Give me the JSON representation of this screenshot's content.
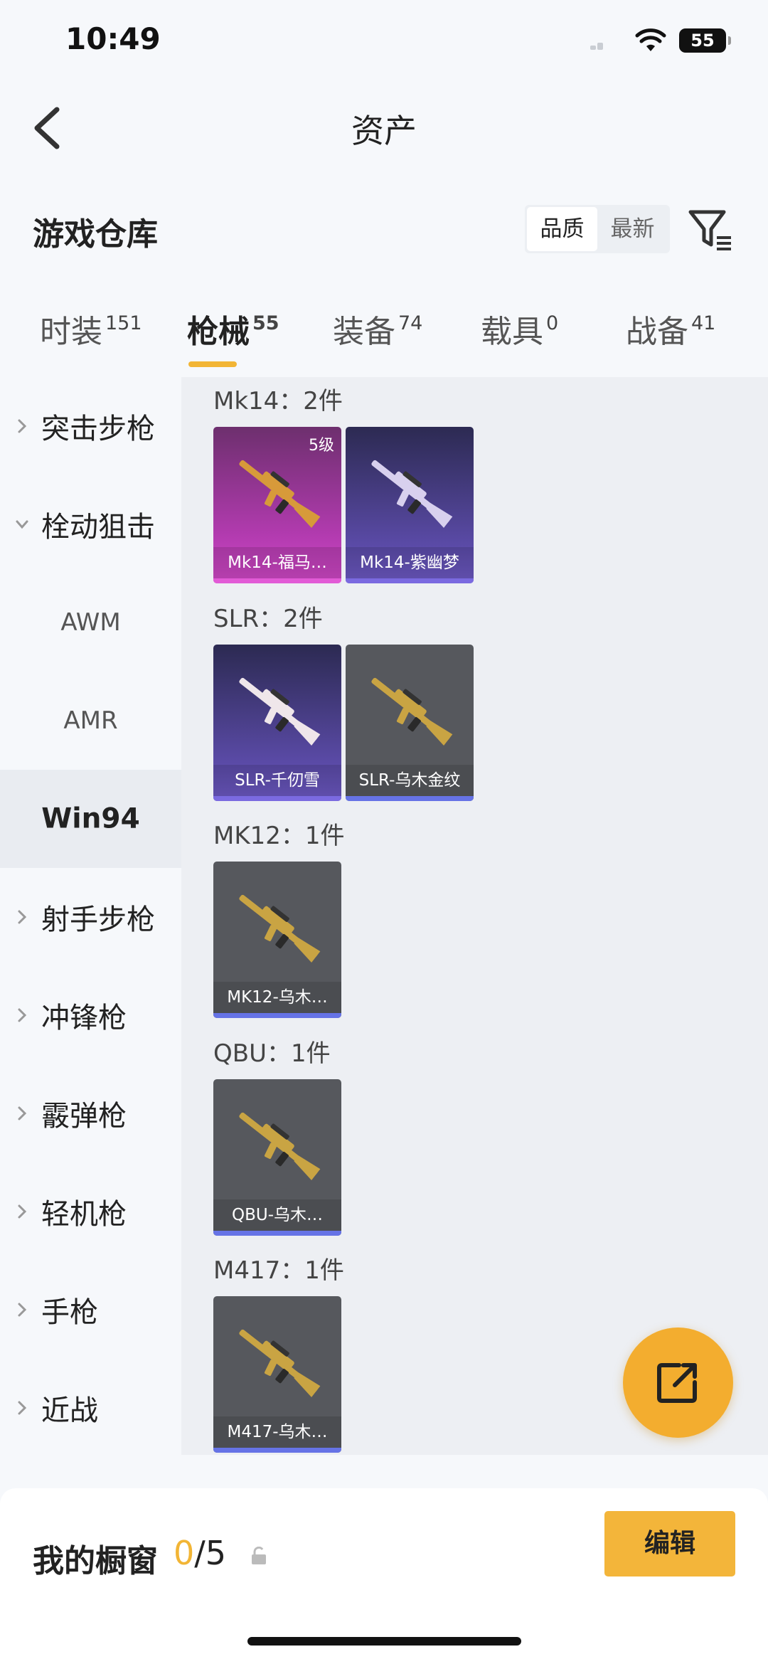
{
  "status_bar": {
    "time": "10:49",
    "battery": "55"
  },
  "header": {
    "title": "资产"
  },
  "warehouse": {
    "title": "游戏仓库",
    "sort_options": [
      "品质",
      "最新"
    ],
    "sort_selected": "品质"
  },
  "tabs": [
    {
      "label": "时装",
      "count": "151"
    },
    {
      "label": "枪械",
      "count": "55"
    },
    {
      "label": "装备",
      "count": "74"
    },
    {
      "label": "载具",
      "count": "0"
    },
    {
      "label": "战备",
      "count": "41"
    }
  ],
  "active_tab": "枪械",
  "sidebar": {
    "items": [
      {
        "label": "突击步枪",
        "chevron": "right"
      },
      {
        "label": "栓动狙击",
        "chevron": "down"
      },
      {
        "label": "AWM",
        "sub": true
      },
      {
        "label": "AMR",
        "sub": true
      },
      {
        "label": "Win94",
        "sub": true,
        "selected": true
      },
      {
        "label": "射手步枪",
        "chevron": "right"
      },
      {
        "label": "冲锋枪",
        "chevron": "right"
      },
      {
        "label": "霰弹枪",
        "chevron": "right"
      },
      {
        "label": "轻机枪",
        "chevron": "right"
      },
      {
        "label": "手枪",
        "chevron": "right"
      },
      {
        "label": "近战",
        "chevron": "right"
      }
    ]
  },
  "groups": [
    {
      "title": "Mk14：2件",
      "items": [
        {
          "name": "Mk14-福马…",
          "level": "5级",
          "rarity": "pink",
          "gun_color": "#d79a3a"
        },
        {
          "name": "Mk14-紫幽梦",
          "rarity": "purple",
          "gun_color": "#d8d0ee"
        }
      ]
    },
    {
      "title": "SLR：2件",
      "items": [
        {
          "name": "SLR-千仞雪",
          "rarity": "purple",
          "gun_color": "#efe6ea"
        },
        {
          "name": "SLR-乌木金纹",
          "rarity": "gray",
          "gun_color": "#c9a443"
        }
      ]
    },
    {
      "title": "MK12：1件",
      "items": [
        {
          "name": "MK12-乌木…",
          "rarity": "gray",
          "gun_color": "#c9a443"
        }
      ]
    },
    {
      "title": "QBU：1件",
      "items": [
        {
          "name": "QBU-乌木…",
          "rarity": "gray",
          "gun_color": "#c9a443"
        }
      ]
    },
    {
      "title": "M417：1件",
      "items": [
        {
          "name": "M417-乌木…",
          "rarity": "gray",
          "gun_color": "#c9a443"
        }
      ]
    }
  ],
  "showcase": {
    "title": "我的橱窗",
    "current": "0",
    "total": "/5",
    "edit_label": "编辑"
  },
  "colors": {
    "accent": "#f2b535",
    "fab": "#f3ad2f",
    "edit_button": "#f3b53a"
  },
  "icons": [
    "back-icon",
    "filter-icon",
    "share-icon",
    "lock-icon",
    "chevron-right-icon",
    "chevron-down-icon"
  ]
}
